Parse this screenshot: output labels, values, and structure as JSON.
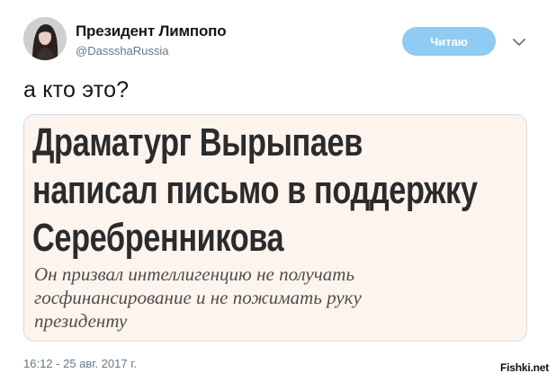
{
  "author": {
    "name": "Президент Лимпопо",
    "handle": "@DassshaRussia"
  },
  "follow_button": {
    "label": "Читаю"
  },
  "tweet": {
    "text": "а кто это?",
    "timestamp": "16:12 - 25 авг. 2017 г."
  },
  "media": {
    "headline_lines": [
      "Драматург Вырыпаев",
      "написал письмо в поддержку",
      "Серебренникова"
    ],
    "subheadline_lines": [
      "Он призвал интеллигенцию не получать",
      "госфинансирование и не пожимать руку",
      "президенту"
    ]
  },
  "watermark": "Fishki.net",
  "colors": {
    "follow_button_bg": "#8fcbf2",
    "card_bg": "#fdf4ee",
    "muted_text": "#657786"
  },
  "icons": {
    "avatar": "user-avatar-photo",
    "menu": "chevron-down-icon"
  }
}
